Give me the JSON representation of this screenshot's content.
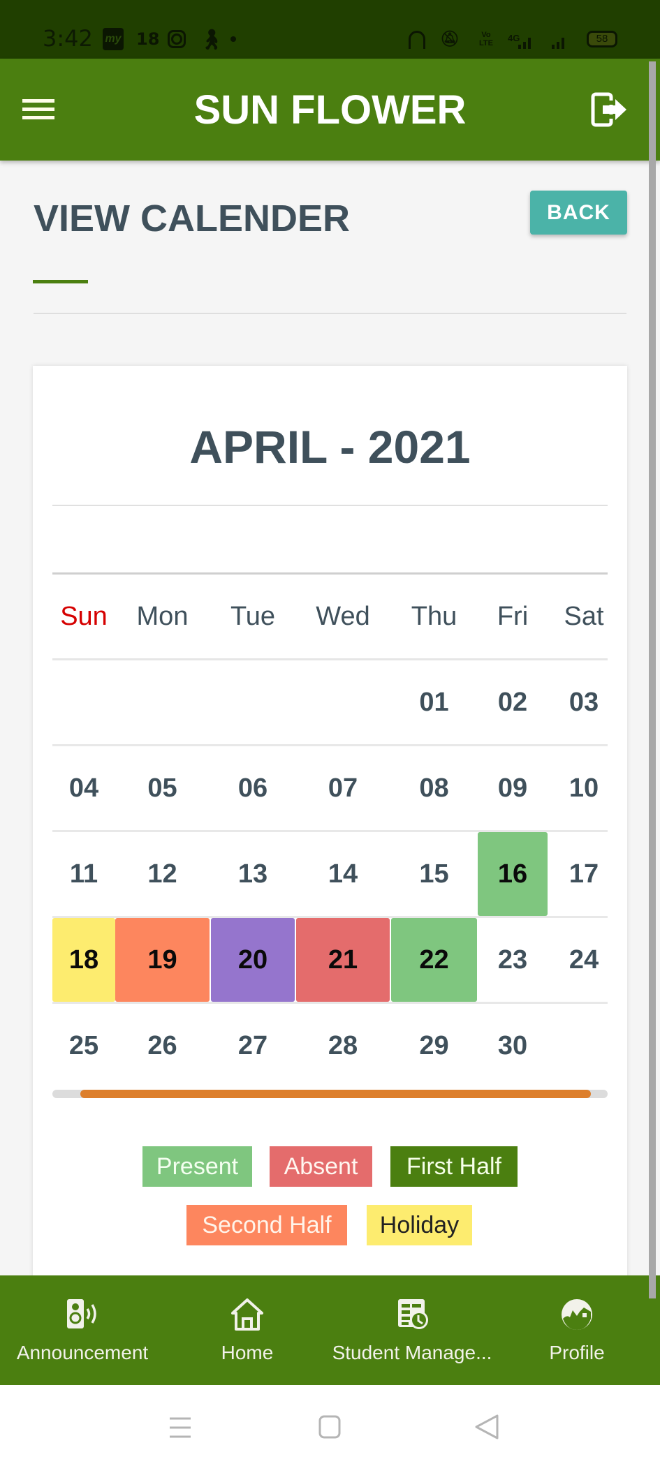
{
  "status_bar": {
    "time": "3:42",
    "notification_icons": [
      "my-app-icon",
      "18-badge",
      "instagram-icon",
      "walking-icon",
      "dot-icon"
    ],
    "notification_18": "18",
    "system_icons": [
      "headset-icon",
      "vibrate-mute-icon",
      "volte-icon",
      "4g-signal-icon",
      "signal-icon",
      "battery-icon"
    ],
    "volte": "VoLTE",
    "network": "4G",
    "battery": "58"
  },
  "app_bar": {
    "title": "SUN FLOWER",
    "menu_icon": "hamburger-menu-icon",
    "exit_icon": "logout-icon"
  },
  "page": {
    "title": "VIEW CALENDER",
    "back_label": "BACK"
  },
  "calendar": {
    "month_title": "APRIL - 2021",
    "weekdays": [
      "Sun",
      "Mon",
      "Tue",
      "Wed",
      "Thu",
      "Fri",
      "Sat"
    ],
    "weeks": [
      [
        "",
        "",
        "",
        "",
        "01",
        "02",
        "03"
      ],
      [
        "04",
        "05",
        "06",
        "07",
        "08",
        "09",
        "10"
      ],
      [
        "11",
        "12",
        "13",
        "14",
        "15",
        "16",
        "17"
      ],
      [
        "18",
        "19",
        "20",
        "21",
        "22",
        "23",
        "24"
      ],
      [
        "25",
        "26",
        "27",
        "28",
        "29",
        "30",
        ""
      ]
    ],
    "marked_days": {
      "16": "present",
      "18": "holiday",
      "19": "second_half",
      "20": "other",
      "21": "absent",
      "22": "present"
    },
    "status_colors": {
      "present": "#7fc67f",
      "absent": "#e46c6c",
      "first_half": "#4b7f10",
      "second_half": "#fd865e",
      "holiday": "#fdec6f",
      "other": "#9575cd"
    },
    "horizontal_scroll": {
      "position_fraction": 0.05,
      "visible_fraction": 0.92
    }
  },
  "legend": [
    {
      "key": "present",
      "label": "Present",
      "bg": "#7fc67f",
      "fg": "#f4fff0"
    },
    {
      "key": "absent",
      "label": "Absent",
      "bg": "#e46c6c",
      "fg": "#fff6f0"
    },
    {
      "key": "first_half",
      "label": "First Half",
      "bg": "#4b7f10",
      "fg": "#f6ffe8"
    },
    {
      "key": "second_half",
      "label": "Second Half",
      "bg": "#fd865e",
      "fg": "#fff4ea"
    },
    {
      "key": "holiday",
      "label": "Holiday",
      "bg": "#fdec6f",
      "fg": "#222222"
    }
  ],
  "bottom_nav": [
    {
      "label": "Announcement",
      "icon": "speaker-icon"
    },
    {
      "label": "Home",
      "icon": "home-icon"
    },
    {
      "label": "Student Manage...",
      "icon": "schedule-table-icon"
    },
    {
      "label": "Profile",
      "icon": "profile-face-icon"
    }
  ],
  "system_nav": [
    "recents-icon",
    "home-square-icon",
    "back-triangle-icon"
  ],
  "theme": {
    "primary": "#4b7f10",
    "status_bar": "#203f00",
    "accent_button": "#4bb3a8",
    "heading_text": "#3f505b",
    "sunday": "#d50000",
    "scroll_thumb": "#dd7f2c"
  }
}
